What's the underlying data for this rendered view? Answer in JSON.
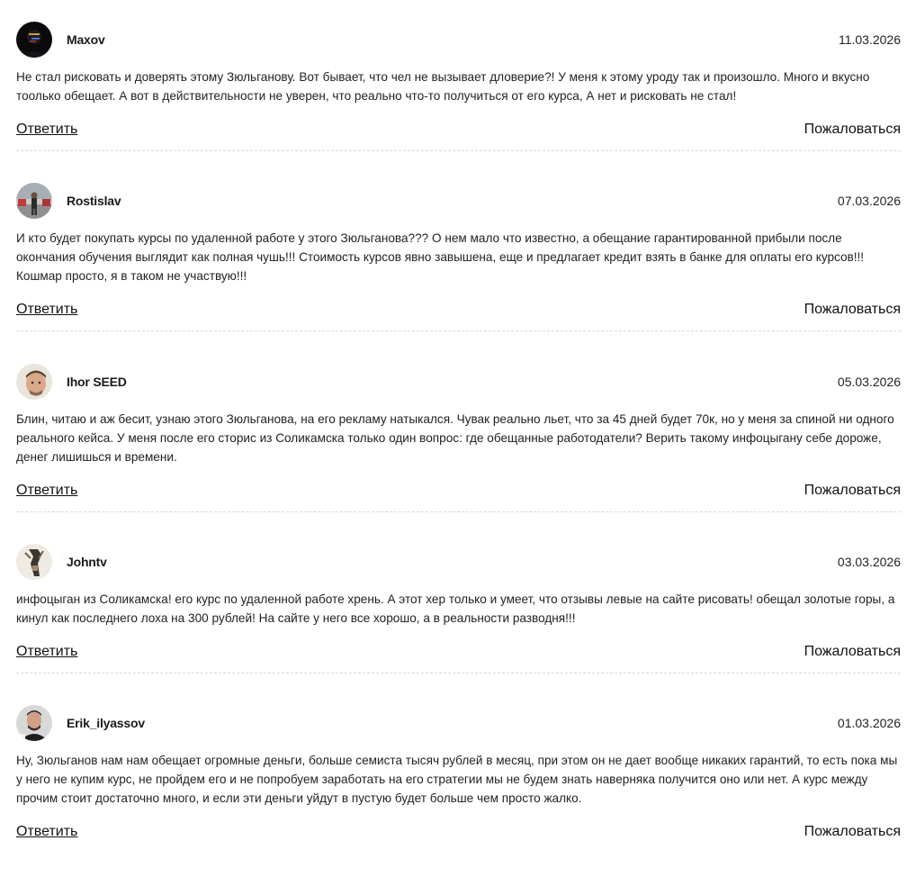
{
  "comments": [
    {
      "author": "Maxov",
      "date": "11.03.2026",
      "avatar_icon": "user-avatar-dark",
      "text": "Не стал рисковать и доверять этому Зюльганову. Вот бывает, что чел не вызывает дловерие?! У меня к этому уроду так и произошло. Много и вкусно тоолько обещает. А вот в действительности не уверен, что реально что-то получиться от его курса, А нет и рисковать не стал!",
      "reply_label": "Ответить",
      "report_label": "Пожаловаться"
    },
    {
      "author": "Rostislav",
      "date": "07.03.2026",
      "avatar_icon": "user-avatar-street",
      "text": "И кто будет покупать курсы по удаленной работе у этого Зюльганова??? О нем мало что известно, а обещание гарантированной прибыли после окончания обучения выглядит как полная чушь!!! Стоимость курсов явно завышена, еще и предлагает кредит взять в банке для оплаты его курсов!!! Кошмар просто, я в таком не участвую!!!",
      "reply_label": "Ответить",
      "report_label": "Пожаловаться"
    },
    {
      "author": "Ihor SEED",
      "date": "05.03.2026",
      "avatar_icon": "user-avatar-face",
      "text": "Блин, читаю и аж бесит, узнаю этого Зюльганова, на его рекламу натыкался. Чувак реально льет, что за 45 дней будет 70к, но у меня за спиной ни одного реального кейса. У меня после его сторис из Соликамска только один вопрос: где обещанные работодатели? Верить такому инфоцыгану себе дороже, денег лишишься и времени.",
      "reply_label": "Ответить",
      "report_label": "Пожаловаться"
    },
    {
      "author": "Johntv",
      "date": "03.03.2026",
      "avatar_icon": "user-avatar-figure",
      "text": "инфоцыган из Соликамска! его курс по удаленной работе хрень. А этот хер только и умеет, что отзывы левые на сайте рисовать! обещал золотые горы, а кинул как последнего лоха на 300 рублей! На сайте у него все хорошо, а в реальности разводня!!!",
      "reply_label": "Ответить",
      "report_label": "Пожаловаться"
    },
    {
      "author": "Erik_ilyassov",
      "date": "01.03.2026",
      "avatar_icon": "user-avatar-portrait",
      "text": "Ну, Зюльганов нам нам обещает огромные деньги, больше семиста тысяч рублей в месяц, при этом он не дает вообще никаких гарантий, то есть пока мы у него не купим курс, не пройдем его и не попробуем заработать на его стратегии мы не будем знать наверняка получится оно или нет. А курс между прочим стоит достаточно много, и если эти деньги уйдут в пустую будет больше чем просто жалко.",
      "reply_label": "Ответить",
      "report_label": "Пожаловаться"
    }
  ]
}
